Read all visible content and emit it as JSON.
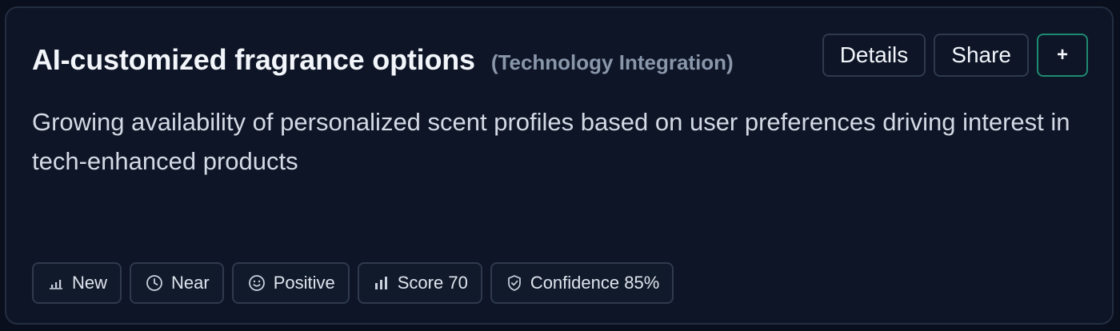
{
  "card": {
    "title": "AI-customized fragrance options",
    "category": "(Technology Integration)",
    "description": "Growing availability of personalized scent profiles based on user preferences driving interest in tech-enhanced products",
    "actions": {
      "details_label": "Details",
      "share_label": "Share",
      "add_label": "+"
    },
    "chips": [
      {
        "icon": "bar-chart-icon",
        "label": "New"
      },
      {
        "icon": "clock-icon",
        "label": "Near"
      },
      {
        "icon": "smiley-icon",
        "label": "Positive"
      },
      {
        "icon": "signal-bars-icon",
        "label": "Score 70"
      },
      {
        "icon": "shield-check-icon",
        "label": "Confidence 85%"
      }
    ]
  },
  "colors": {
    "page_background": "#0a0f1e",
    "card_background": "#0d1526",
    "card_border": "#232e41",
    "category_text": "#8a97ab",
    "accent_border": "#1f8a72"
  }
}
